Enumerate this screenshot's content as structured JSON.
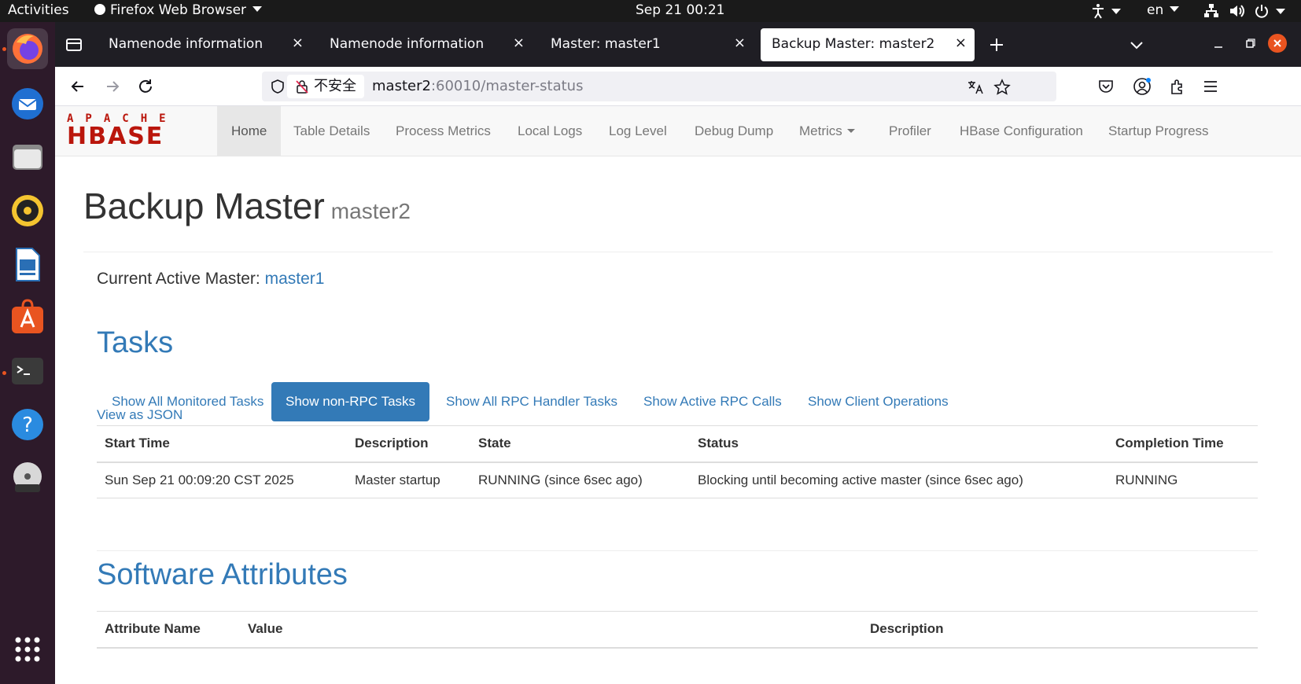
{
  "system_bar": {
    "activities": "Activities",
    "app_name": "Firefox Web Browser",
    "clock": "Sep 21  00:21",
    "language": "en"
  },
  "tabs": [
    {
      "title": "Namenode information",
      "close": "×"
    },
    {
      "title": "Namenode information",
      "close": "×"
    },
    {
      "title": "Master: master1",
      "close": "×"
    },
    {
      "title": "Backup Master: master2",
      "close": "×"
    }
  ],
  "address_bar": {
    "security_label": "不安全",
    "url_host": "master2",
    "url_rest": ":60010/master-status"
  },
  "hbase_nav": {
    "logo_top": "APACHE",
    "logo_bottom": "HBASE",
    "items": [
      "Home",
      "Table Details",
      "Process Metrics",
      "Local Logs",
      "Log Level",
      "Debug Dump",
      "Metrics",
      "Profiler",
      "HBase Configuration",
      "Startup Progress"
    ]
  },
  "page": {
    "title": "Backup Master",
    "subtitle": "master2",
    "active_master_label": "Current Active Master:",
    "active_master_value": "master1"
  },
  "tasks": {
    "heading": "Tasks",
    "filters": [
      "Show All Monitored Tasks",
      "Show non-RPC Tasks",
      "Show All RPC Handler Tasks",
      "Show Active RPC Calls",
      "Show Client Operations"
    ],
    "active_filter_index": 1,
    "view_json": "View as JSON",
    "columns": [
      "Start Time",
      "Description",
      "State",
      "Status",
      "Completion Time"
    ],
    "rows": [
      [
        "Sun Sep 21 00:09:20 CST 2025",
        "Master startup",
        "RUNNING (since 6sec ago)",
        "Blocking until becoming active master (since 6sec ago)",
        "RUNNING"
      ]
    ]
  },
  "software_attributes": {
    "heading": "Software Attributes",
    "columns": [
      "Attribute Name",
      "Value",
      "Description"
    ]
  },
  "colors": {
    "link": "#337ab7",
    "hbase_red": "#ba160c",
    "dock_bg": "#2d1a2a"
  }
}
